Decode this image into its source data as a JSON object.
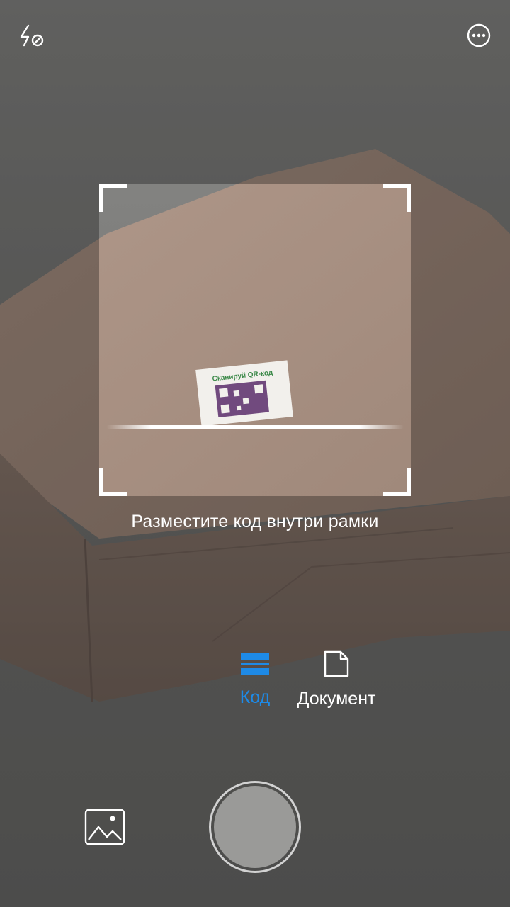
{
  "top_bar": {
    "flash_icon": "flash-off-icon",
    "more_icon": "more-options-icon"
  },
  "scanner": {
    "hint": "Разместите код внутри рамки"
  },
  "modes": [
    {
      "label": "Код",
      "icon": "barcode-scan-icon",
      "selected": true
    },
    {
      "label": "Документ",
      "icon": "document-icon",
      "selected": false
    }
  ],
  "bottom_bar": {
    "gallery_icon": "gallery-image-icon",
    "shutter_icon": "shutter-icon"
  },
  "colors": {
    "accent": "#1e8ae6",
    "text": "#ffffff"
  },
  "photo": {
    "label_text": "Сканируй QR-код"
  }
}
